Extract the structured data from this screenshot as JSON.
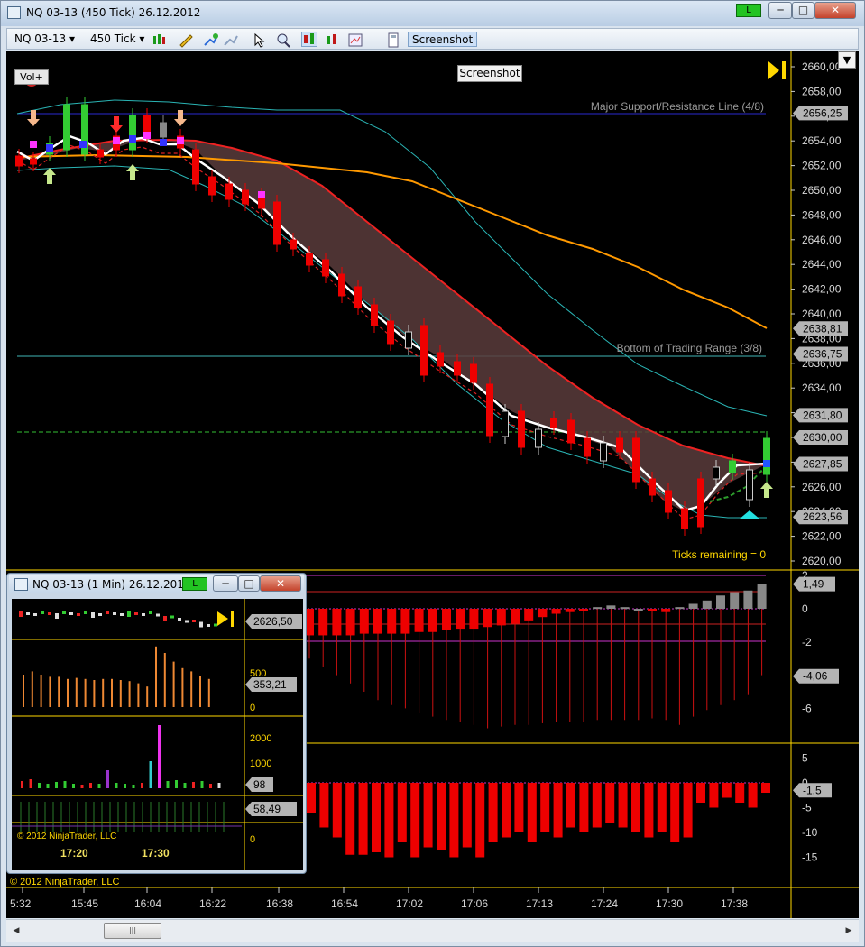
{
  "window": {
    "title": "NQ 03-13 (450 Tick)  26.12.2012",
    "badge": "L",
    "min": "─",
    "max": "□",
    "close": "✕"
  },
  "toolbar": {
    "instrument": "NQ 03-13",
    "interval": "450 Tick",
    "screenshot_button": "Screenshot",
    "icons": [
      "bar-type-icon",
      "draw-pen-icon",
      "add-indicator-icon",
      "remove-indicator-icon",
      "cursor-icon",
      "zoom-icon",
      "chart-style-1-icon",
      "chart-style-2-icon",
      "chart-properties-icon",
      "data-box-icon"
    ]
  },
  "chart": {
    "vol_button": "Vol+",
    "screenshot_label": "Screenshot",
    "menu_arrow": "▼",
    "copyright": "© 2012 NinjaTrader, LLC",
    "annotations": {
      "major_line": "Major Support/Resistance Line (4/8)",
      "bottom_range": "Bottom of Trading Range (3/8)",
      "ticks_remaining": "Ticks remaining = 0"
    },
    "price_labels": [
      "2660,00",
      "2658,00",
      "2656,00",
      "2654,00",
      "2652,00",
      "2650,00",
      "2648,00",
      "2646,00",
      "2644,00",
      "2642,00",
      "2640,00",
      "2638,00",
      "2636,00",
      "2634,00",
      "2632,00",
      "2630,00",
      "2628,00",
      "2626,00",
      "2624,00",
      "2622,00",
      "2620,00"
    ],
    "price_tags": [
      "2656,25",
      "2638,81",
      "2636,75",
      "2631,80",
      "2630,00",
      "2627,85",
      "2623,56"
    ],
    "panel2_labels": [
      "2",
      "0",
      "-2",
      "-4",
      "-6"
    ],
    "panel2_tags": [
      "1,49",
      "-4,06"
    ],
    "panel3_labels": [
      "5",
      "0",
      "-5",
      "-10",
      "-15"
    ],
    "panel3_tags": [
      "-1,5"
    ],
    "time_labels": [
      "5:32",
      "15:45",
      "16:04",
      "16:22",
      "16:38",
      "16:54",
      "17:02",
      "17:06",
      "17:13",
      "17:24",
      "17:30",
      "17:38"
    ]
  },
  "scrollbar": {
    "left_arrow": "◀",
    "right_arrow": "▶",
    "thumb": "|||"
  },
  "sub_window": {
    "title": "NQ 03-13 (1 Min)  26.12.2012",
    "badge": "L",
    "min": "─",
    "max": "□",
    "close": "✕",
    "price_tag": "2626,50",
    "vol_labels": [
      "500",
      "0"
    ],
    "vol_tag": "353,21",
    "p3_labels": [
      "2000",
      "1000",
      "0"
    ],
    "p3_tag": "98",
    "p4_labels": [
      "0"
    ],
    "p4_tag": "58,49",
    "copyright": "© 2012 NinjaTrader, LLC",
    "time_labels": [
      "17:20",
      "17:30"
    ]
  },
  "colors": {
    "background": "#000000",
    "down": "#ff0000",
    "up": "#33cc33",
    "gold": "#ffd700",
    "orange_ma": "#ff9900",
    "cyan_band": "#2ab4b4",
    "ribbon": "#5a3c3c"
  }
}
